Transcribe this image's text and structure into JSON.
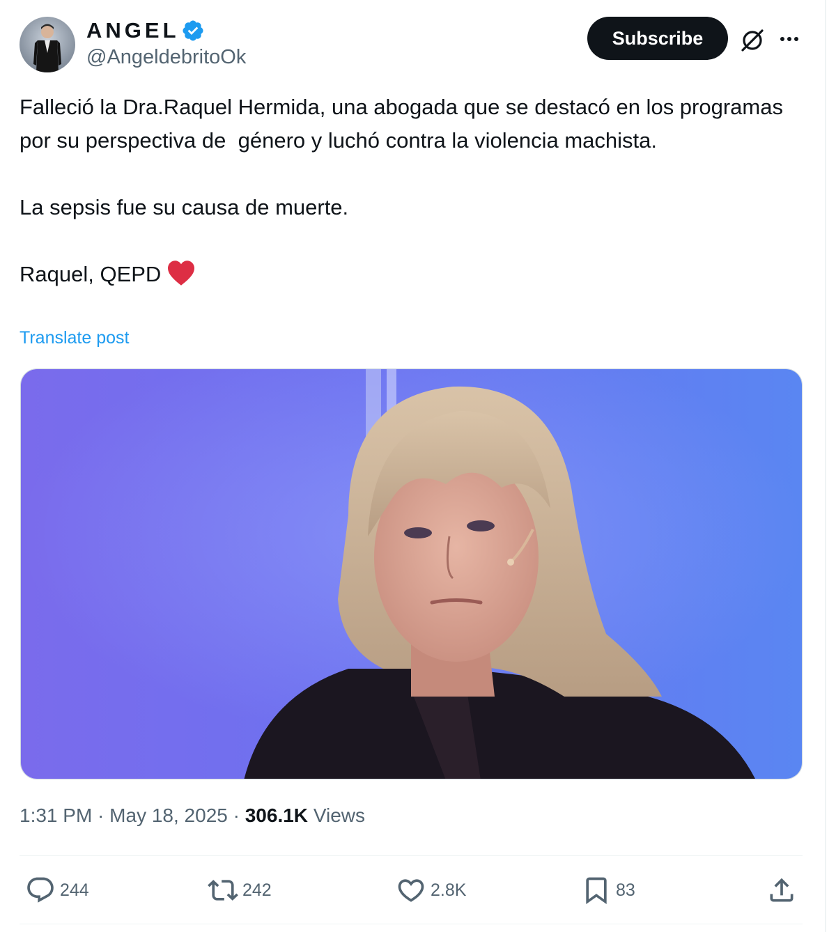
{
  "author": {
    "display_name": "ANGEL",
    "handle": "@AngeldebritoOk"
  },
  "header": {
    "subscribe_label": "Subscribe"
  },
  "post": {
    "paragraph1": "Falleció la Dra.Raquel Hermida, una abogada que se destacó en los programas por su perspectiva de  género y luchó contra la violencia machista.",
    "paragraph2": "La sepsis fue su causa de muerte.",
    "paragraph3": "Raquel, QEPD",
    "translate_label": "Translate post"
  },
  "meta": {
    "time": "1:31 PM",
    "separator": " · ",
    "date": "May 18, 2025",
    "views_count": "306.1K",
    "views_label": "Views"
  },
  "actions": {
    "replies": "244",
    "reposts": "242",
    "likes": "2.8K",
    "bookmarks": "83"
  },
  "colors": {
    "accent": "#1d9bf0",
    "text_primary": "#0f1419",
    "text_secondary": "#536471",
    "heart": "#e0245e"
  },
  "icons": [
    "verified-badge-icon",
    "grok-icon",
    "more-icon",
    "reply-icon",
    "retweet-icon",
    "like-icon",
    "bookmark-icon",
    "share-icon",
    "red-heart-emoji"
  ]
}
